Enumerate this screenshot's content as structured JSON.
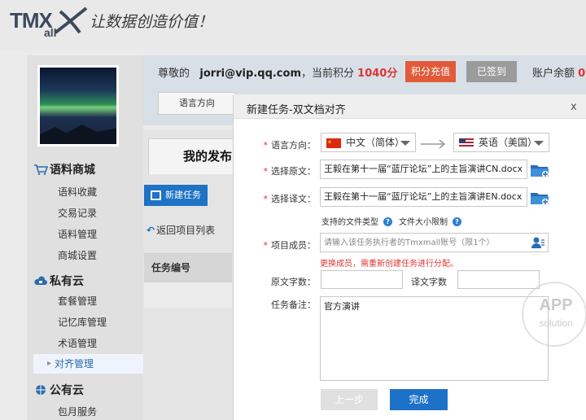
{
  "brand": {
    "logo_main": "TMX",
    "logo_sub": "all",
    "slogan": "让数据创造价值！"
  },
  "sidebar": {
    "sections": [
      {
        "title": "语料商城",
        "items": [
          "语料收藏",
          "交易记录",
          "语料管理",
          "商城设置"
        ]
      },
      {
        "title": "私有云",
        "items": [
          "套餐管理",
          "记忆库管理",
          "术语管理",
          "对齐管理"
        ]
      },
      {
        "title": "公有云",
        "items": [
          "包月服务"
        ]
      }
    ]
  },
  "header": {
    "greeting_prefix": "尊敬的",
    "email": "jorri@vip.qq.com",
    "points_label": "，当前积分",
    "points_value": "1040分",
    "recharge_button": "积分充值",
    "signed_button": "已签到",
    "balance_label": "账户余额",
    "balance_value": "0",
    "lang_tab": "语言方向"
  },
  "main": {
    "my_tab": "我的发布",
    "new_task_button": "新建任务",
    "back_link": "返回项目列表",
    "table_header": "任务编号"
  },
  "modal": {
    "title": "新建任务-双文档对齐",
    "close": "x",
    "lang_label": "语言方向：",
    "source_lang": "中文（简体）",
    "target_lang": "英语（美国）",
    "source_doc_label": "选择原文：",
    "source_doc_value": "王毅在第十一届“蓝厅论坛”上的主旨演讲CN.docx",
    "target_doc_label": "选择译文：",
    "target_doc_value": "王毅在第十一届“蓝厅论坛”上的主旨演讲EN.docx",
    "file_types_hint": "支持的文件类型",
    "file_size_hint": "文件大小限制",
    "member_label": "项目成员：",
    "member_placeholder": "请输入该任务执行者的Tmxmall账号（限1个）",
    "member_warning": "更换成员，需重新创建任务进行分配。",
    "source_count_label": "原文字数：",
    "target_count_label": "译文字数",
    "notes_label": "任务备注：",
    "notes_value": "官方演讲",
    "prev_button": "上一步",
    "done_button": "完成"
  },
  "watermark": {
    "line1": "APP",
    "line2": "solution"
  },
  "colors": {
    "accent": "#1d72c8",
    "danger": "#e15a3a",
    "warning_text": "#dd3333"
  }
}
